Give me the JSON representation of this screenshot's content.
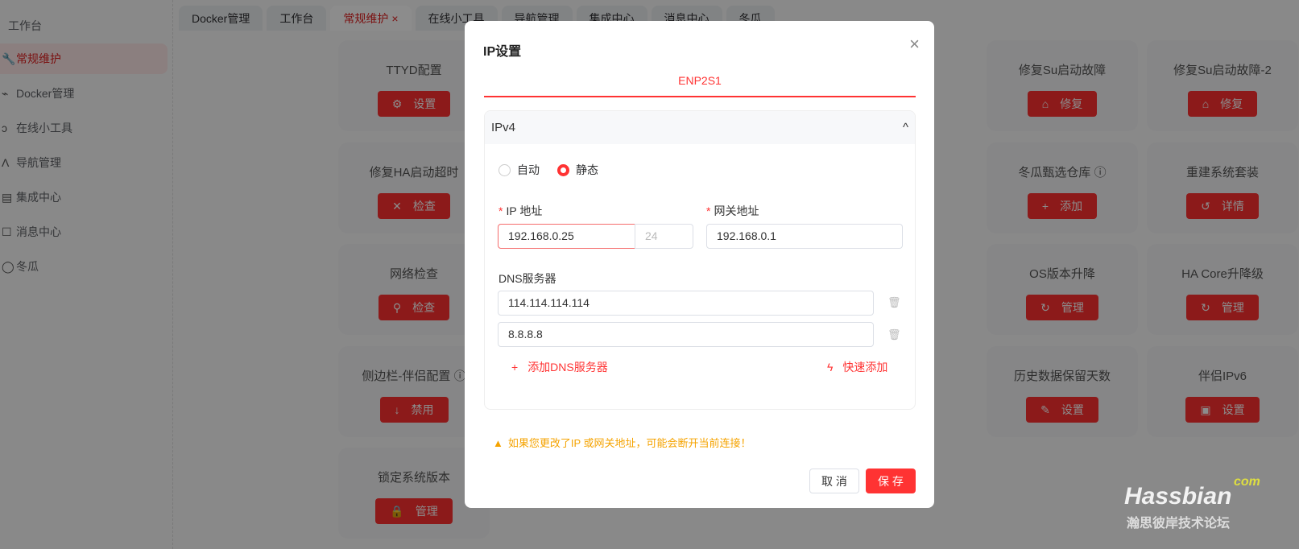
{
  "sidebar": {
    "header": "工作台",
    "items": [
      {
        "label": "常规维护",
        "icon": "wrench-icon",
        "active": true
      },
      {
        "label": "Docker管理",
        "icon": "docker-icon"
      },
      {
        "label": "在线小工具",
        "icon": "tools-icon"
      },
      {
        "label": "导航管理",
        "icon": "navigation-icon"
      },
      {
        "label": "集成中心",
        "icon": "integration-icon"
      },
      {
        "label": "消息中心",
        "icon": "message-icon"
      },
      {
        "label": "冬瓜",
        "icon": "circle-icon"
      }
    ]
  },
  "tabs": [
    {
      "label": "Docker管理"
    },
    {
      "label": "工作台"
    },
    {
      "label": "常规维护",
      "active": true,
      "close": "×"
    },
    {
      "label": "在线小工具"
    },
    {
      "label": "导航管理"
    },
    {
      "label": "集成中心"
    },
    {
      "label": "消息中心"
    },
    {
      "label": "冬瓜"
    }
  ],
  "cards": [
    {
      "title": "TTYD配置",
      "button": "设置",
      "icon": "⚙"
    },
    {
      "title": "修复HA启动超时",
      "button": "检查",
      "icon": "✕"
    },
    {
      "title": "网络检查",
      "button": "检查",
      "icon": "⚲"
    },
    {
      "title": "侧边栏-伴侣配置 ⓘ",
      "button": "禁用",
      "icon": "↓"
    },
    {
      "title": "锁定系统版本",
      "button": "管理",
      "icon": "🔒"
    },
    {
      "title": "修复Su启动故障",
      "button": "修复",
      "icon": "⌂"
    },
    {
      "title": "冬瓜甄选仓库 ⓘ",
      "button": "添加",
      "icon": "+"
    },
    {
      "title": "OS版本升降",
      "button": "管理",
      "icon": "↻"
    },
    {
      "title": "历史数据保留天数",
      "button": "设置",
      "icon": "✎"
    },
    {
      "title": "修复Su启动故障-2",
      "button": "修复",
      "icon": "⌂"
    },
    {
      "title": "重建系统套装",
      "button": "详情",
      "icon": "↺"
    },
    {
      "title": "HA Core升降级",
      "button": "管理",
      "icon": "↻"
    },
    {
      "title": "伴侣IPv6",
      "button": "设置",
      "icon": "▣"
    }
  ],
  "modal": {
    "title": "IP设置",
    "close": "×",
    "interface_tab": "ENP2S1",
    "section": "IPv4",
    "section_icon": "^",
    "mode_options": [
      "自动",
      "静态"
    ],
    "mode_selected": "静态",
    "ip_label": "IP 地址",
    "ip_value": "192.168.0.25",
    "prefix_placeholder": "24",
    "gateway_label": "网关地址",
    "gateway_value": "192.168.0.1",
    "dns_label": "DNS服务器",
    "dns": [
      "114.114.114.114",
      "8.8.8.8"
    ],
    "add_dns": "添加DNS服务器",
    "quick_add": "快速添加",
    "warning": "如果您更改了IP 或网关地址，可能会断开当前连接！",
    "cancel": "取 消",
    "save": "保 存",
    "accent": "#ff3333",
    "warning_color": "#f5a300"
  },
  "watermark": {
    "brand": "Hassbian",
    "suffix": "com",
    "caption": "瀚思彼岸技术论坛"
  }
}
